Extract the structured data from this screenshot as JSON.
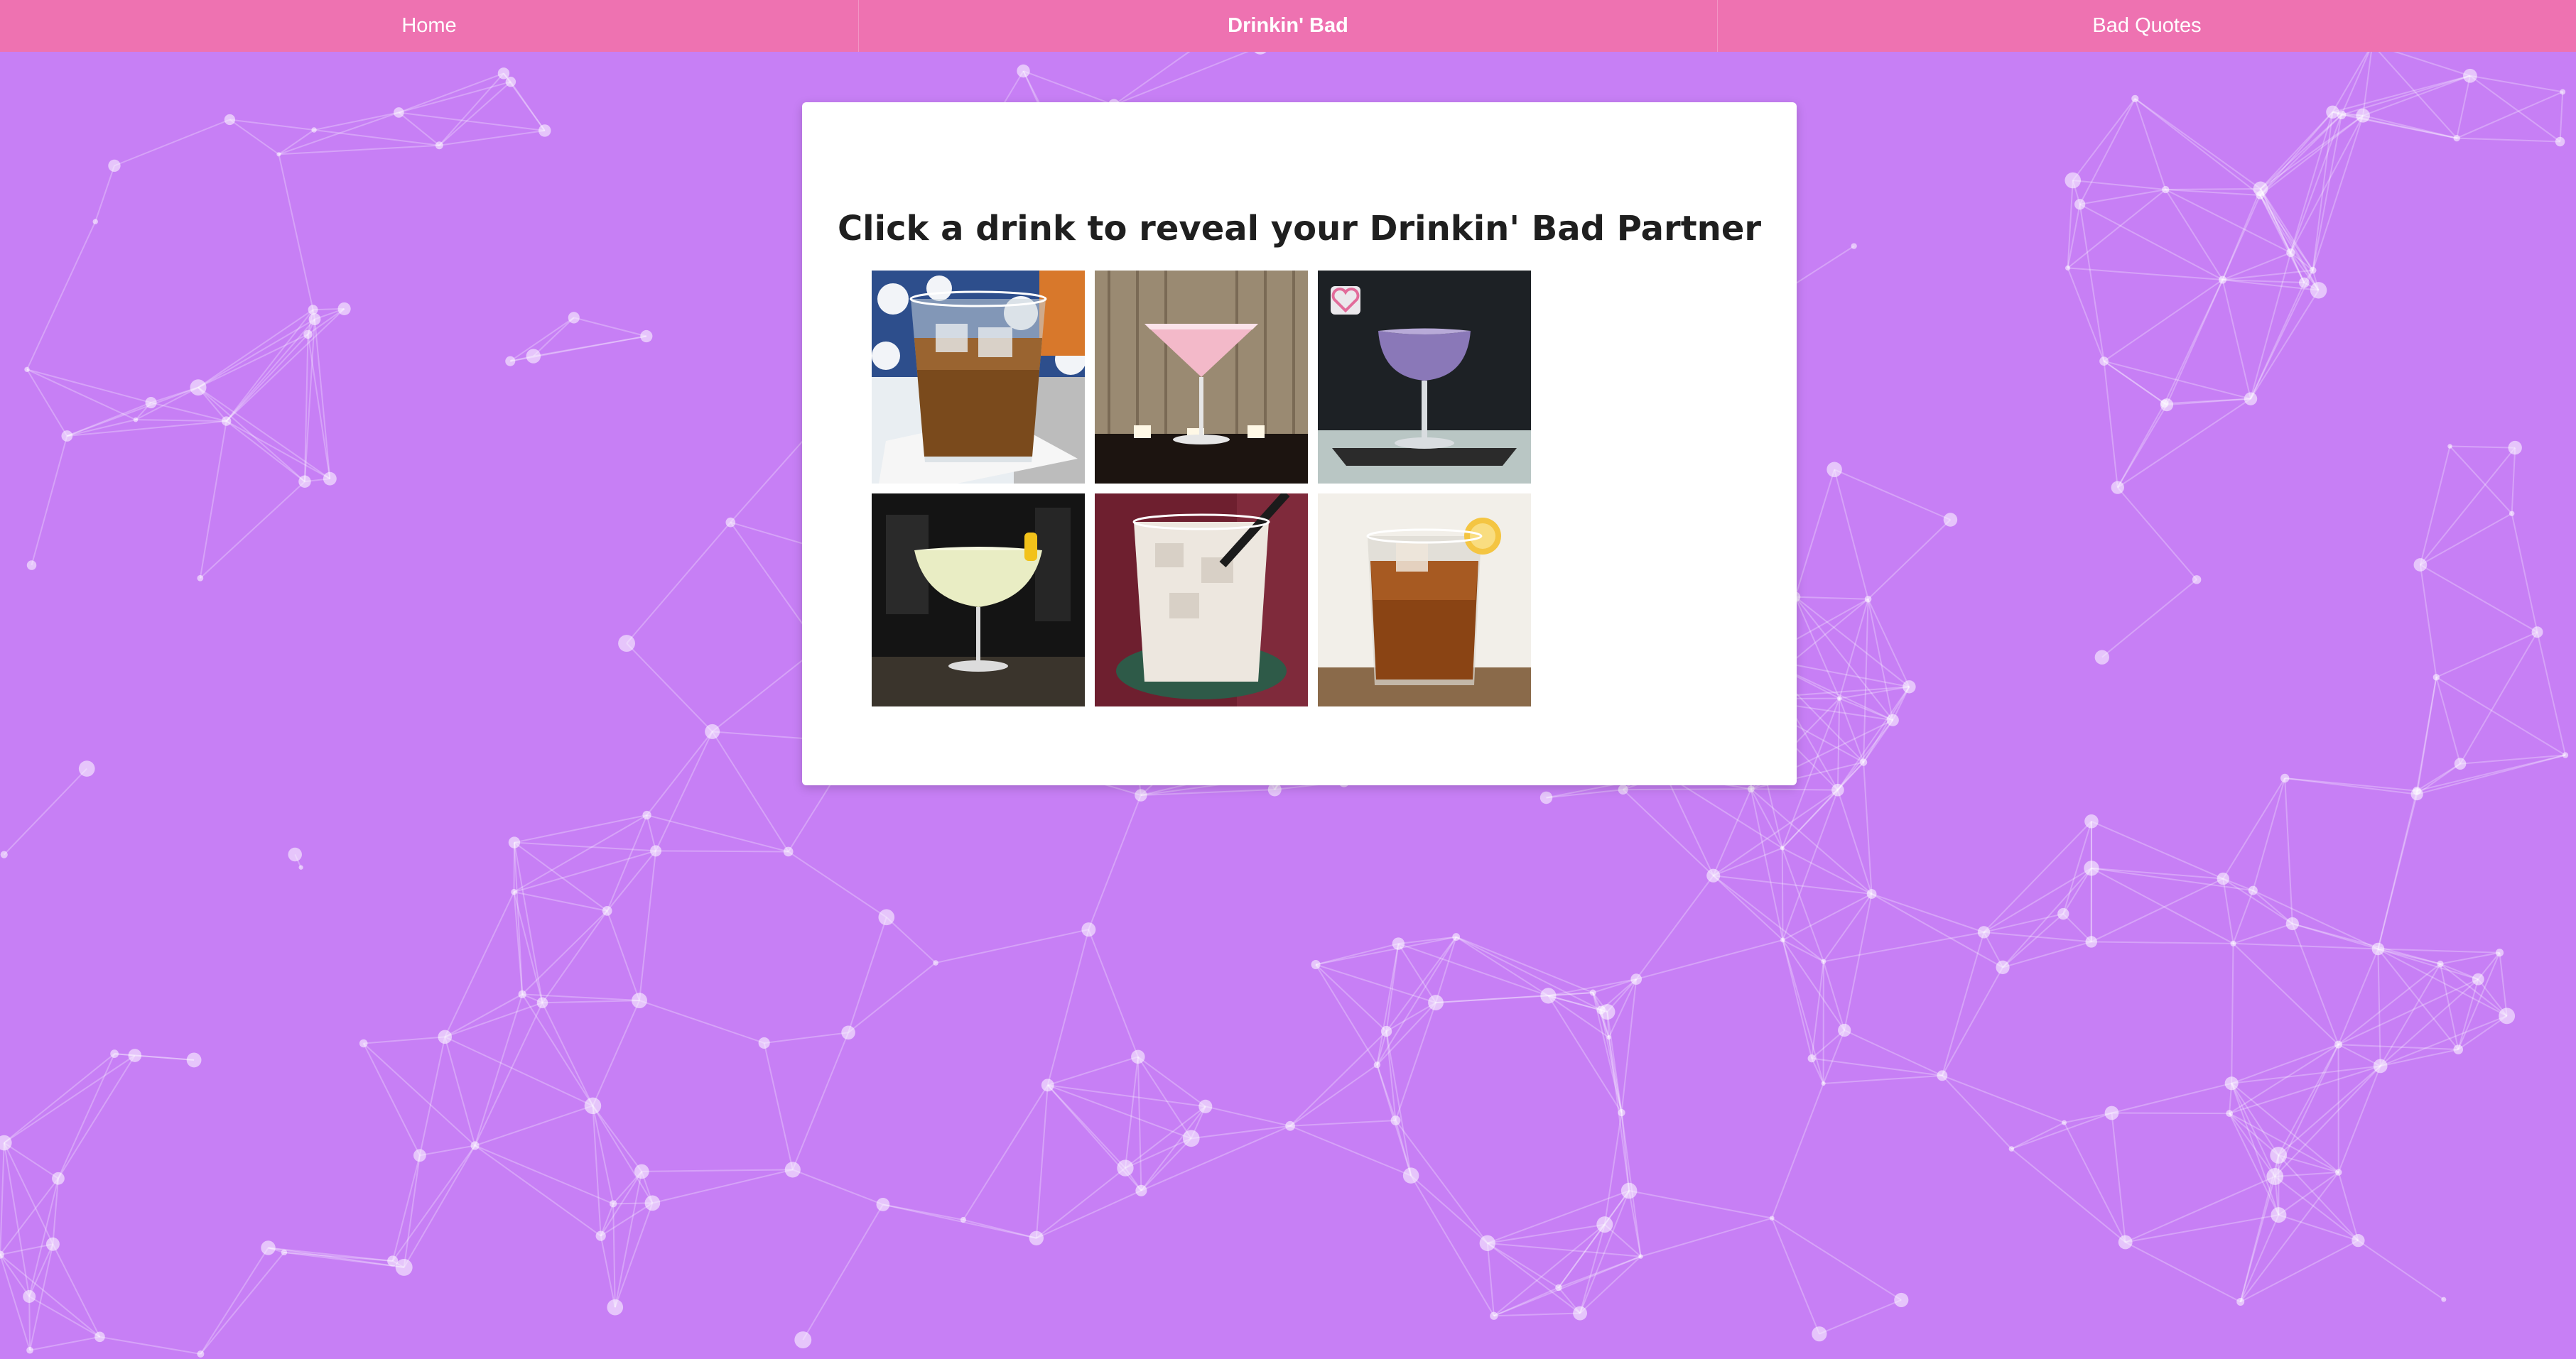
{
  "nav": {
    "items": [
      {
        "label": "Home"
      },
      {
        "label": "Drinkin' Bad"
      },
      {
        "label": "Bad Quotes"
      }
    ],
    "active_index": 1
  },
  "main": {
    "title": "Click a drink to reveal your Drinkin' Bad Partner",
    "drinks": [
      {
        "icon": "whiskey-rocks-drink-image"
      },
      {
        "icon": "pink-martini-drink-image"
      },
      {
        "icon": "purple-coupe-drink-image",
        "favorite": true
      },
      {
        "icon": "white-martini-lemon-drink-image"
      },
      {
        "icon": "white-russian-drink-image"
      },
      {
        "icon": "iced-tea-lemon-drink-image"
      }
    ]
  },
  "colors": {
    "background": "#c77ff5",
    "nav_bar": "#ee72b1",
    "card": "#ffffff",
    "title_text": "#1f1f1f"
  }
}
